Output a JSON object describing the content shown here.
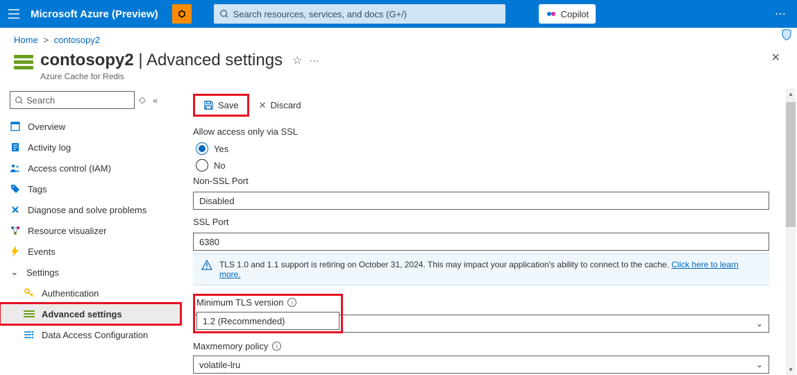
{
  "topbar": {
    "brand": "Microsoft Azure (Preview)",
    "search_placeholder": "Search resources, services, and docs (G+/)",
    "copilot_label": "Copilot"
  },
  "breadcrumb": {
    "home": "Home",
    "resource": "contosopy2"
  },
  "header": {
    "resource_name": "contosopy2",
    "separator": " | ",
    "page_name": "Advanced settings",
    "subtitle": "Azure Cache for Redis"
  },
  "sidebar": {
    "search_placeholder": "Search",
    "items": {
      "overview": "Overview",
      "activity": "Activity log",
      "iam": "Access control (IAM)",
      "tags": "Tags",
      "diagnose": "Diagnose and solve problems",
      "visualizer": "Resource visualizer",
      "events": "Events",
      "settings_group": "Settings",
      "auth": "Authentication",
      "advanced": "Advanced settings",
      "dataaccess": "Data Access Configuration"
    }
  },
  "toolbar": {
    "save": "Save",
    "discard": "Discard"
  },
  "form": {
    "ssl_label": "Allow access only via SSL",
    "yes": "Yes",
    "no": "No",
    "nonssl_label": "Non-SSL Port",
    "nonssl_value": "Disabled",
    "sslport_label": "SSL Port",
    "sslport_value": "6380",
    "banner_text": "TLS 1.0 and 1.1 support is retiring on October 31, 2024. This may impact your application's ability to connect to the cache. ",
    "banner_link": "Click here to learn more.",
    "tls_label": "Minimum TLS version",
    "tls_value": "1.2 (Recommended)",
    "maxmem_label": "Maxmemory policy",
    "maxmem_value": "volatile-lru"
  }
}
